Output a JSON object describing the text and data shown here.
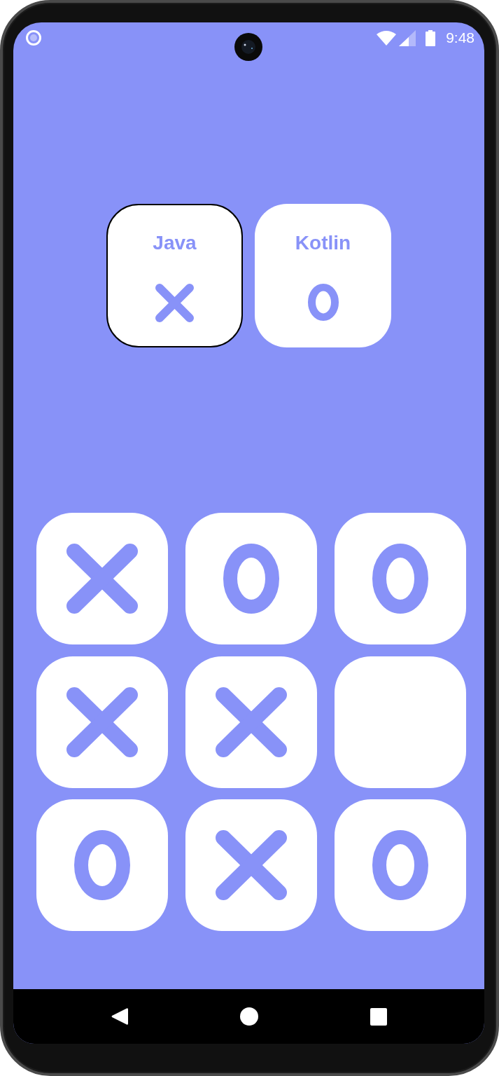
{
  "status_bar": {
    "time": "9:48"
  },
  "players": [
    {
      "name": "Java",
      "kind": "x",
      "selected": true
    },
    {
      "name": "Kotlin",
      "kind": "o",
      "selected": false
    }
  ],
  "board": {
    "cells": [
      {
        "kind": "x"
      },
      {
        "kind": "o"
      },
      {
        "kind": "o"
      },
      {
        "kind": "x"
      },
      {
        "kind": "x"
      },
      {
        "kind": "empty"
      },
      {
        "kind": "o"
      },
      {
        "kind": "x"
      },
      {
        "kind": "o"
      }
    ]
  }
}
